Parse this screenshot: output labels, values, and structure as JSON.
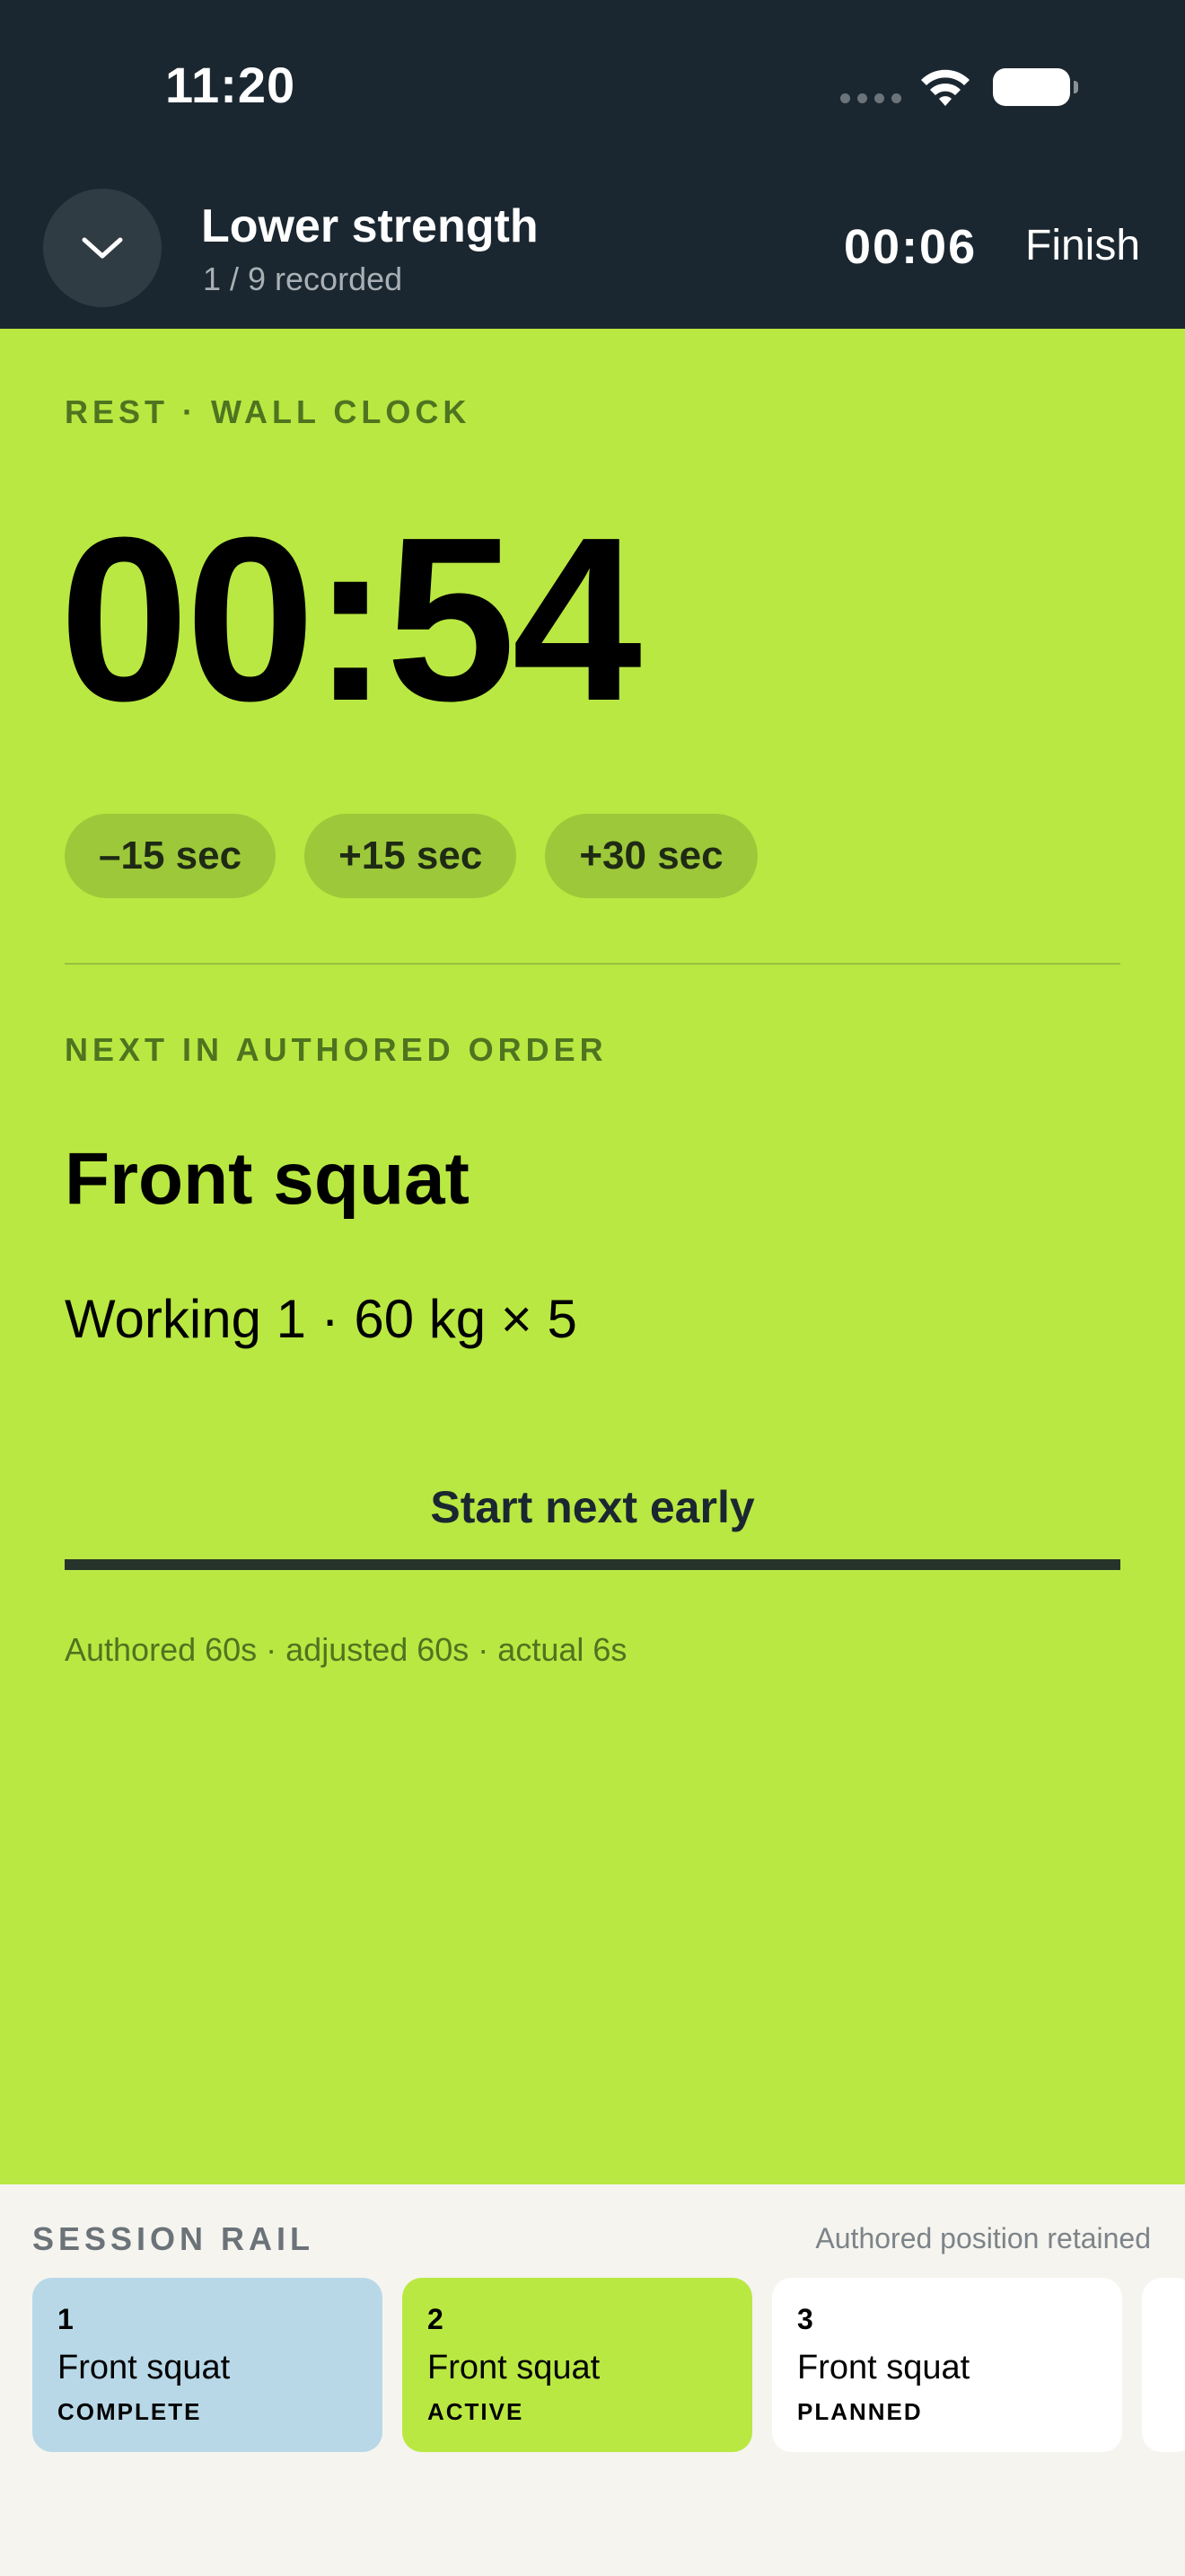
{
  "status_bar": {
    "time": "11:20"
  },
  "header": {
    "workout_title": "Lower strength",
    "recorded": "1 / 9 recorded",
    "elapsed": "00:06",
    "finish_label": "Finish"
  },
  "rest": {
    "label": "REST · WALL CLOCK",
    "countdown": "00:54",
    "adjust_buttons": [
      "–15 sec",
      "+15 sec",
      "+30 sec"
    ]
  },
  "next": {
    "label": "NEXT IN AUTHORED ORDER",
    "exercise": "Front squat",
    "detail": "Working 1 · 60 kg × 5",
    "start_early_label": "Start next early",
    "timing_note": "Authored 60s · adjusted 60s · actual 6s"
  },
  "rail": {
    "title": "SESSION RAIL",
    "note": "Authored position retained",
    "cards": [
      {
        "num": "1",
        "name": "Front squat",
        "status": "COMPLETE"
      },
      {
        "num": "2",
        "name": "Front squat",
        "status": "ACTIVE"
      },
      {
        "num": "3",
        "name": "Front squat",
        "status": "PLANNED"
      }
    ]
  },
  "colors": {
    "header_bg": "#1b2730",
    "accent_lime": "#b9e842",
    "complete_blue": "#b8d8e8",
    "rail_bg": "#f5f4ef"
  },
  "icons": [
    "chevron-down-icon",
    "wifi-icon",
    "battery-icon",
    "signal-icon"
  ]
}
